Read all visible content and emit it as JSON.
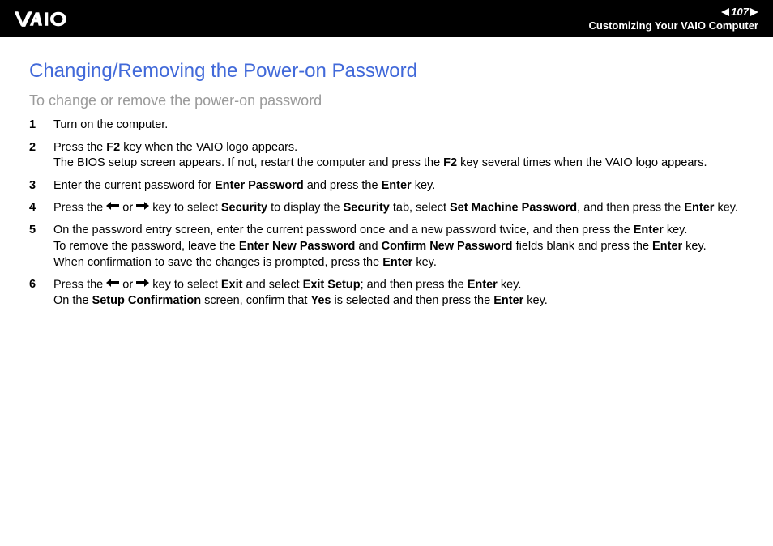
{
  "header": {
    "page_number": "107",
    "section": "Customizing Your VAIO Computer"
  },
  "title": "Changing/Removing the Power-on Password",
  "subtitle": "To change or remove the power-on password",
  "steps": {
    "s1": {
      "t0": "Turn on the computer."
    },
    "s2": {
      "t0": "Press the ",
      "b0": "F2",
      "t1": " key when the VAIO logo appears.",
      "t2": "The BIOS setup screen appears. If not, restart the computer and press the ",
      "b2": "F2",
      "t3": " key several times when the VAIO logo appears."
    },
    "s3": {
      "t0": "Enter the current password for ",
      "b0": "Enter Password",
      "t1": " and press the ",
      "b1": "Enter",
      "t2": " key."
    },
    "s4": {
      "t0": "Press the ",
      "t1": " or ",
      "t2": " key to select ",
      "b0": "Security",
      "t3": " to display the ",
      "b1": "Security",
      "t4": " tab, select ",
      "b2": "Set Machine Password",
      "t5": ", and then press the ",
      "b3": "Enter",
      "t6": " key."
    },
    "s5": {
      "t0": "On the password entry screen, enter the current password once and a new password twice, and then press the ",
      "b0": "Enter",
      "t1": " key.",
      "t2": "To remove the password, leave the ",
      "b2": "Enter New Password",
      "t3": " and ",
      "b3": "Confirm New Password",
      "t4": " fields blank and press the ",
      "b4": "Enter",
      "t5": " key.",
      "t6": "When confirmation to save the changes is prompted, press the ",
      "b6": "Enter",
      "t7": " key."
    },
    "s6": {
      "t0": "Press the ",
      "t1": " or ",
      "t2": " key to select ",
      "b0": "Exit",
      "t3": " and select ",
      "b1": "Exit Setup",
      "t4": "; and then press the ",
      "b2": "Enter",
      "t5": " key.",
      "t6": "On the ",
      "b6": "Setup Confirmation",
      "t7": " screen, confirm that ",
      "b7": "Yes",
      "t8": " is selected and then press the ",
      "b8": "Enter",
      "t9": " key."
    }
  }
}
